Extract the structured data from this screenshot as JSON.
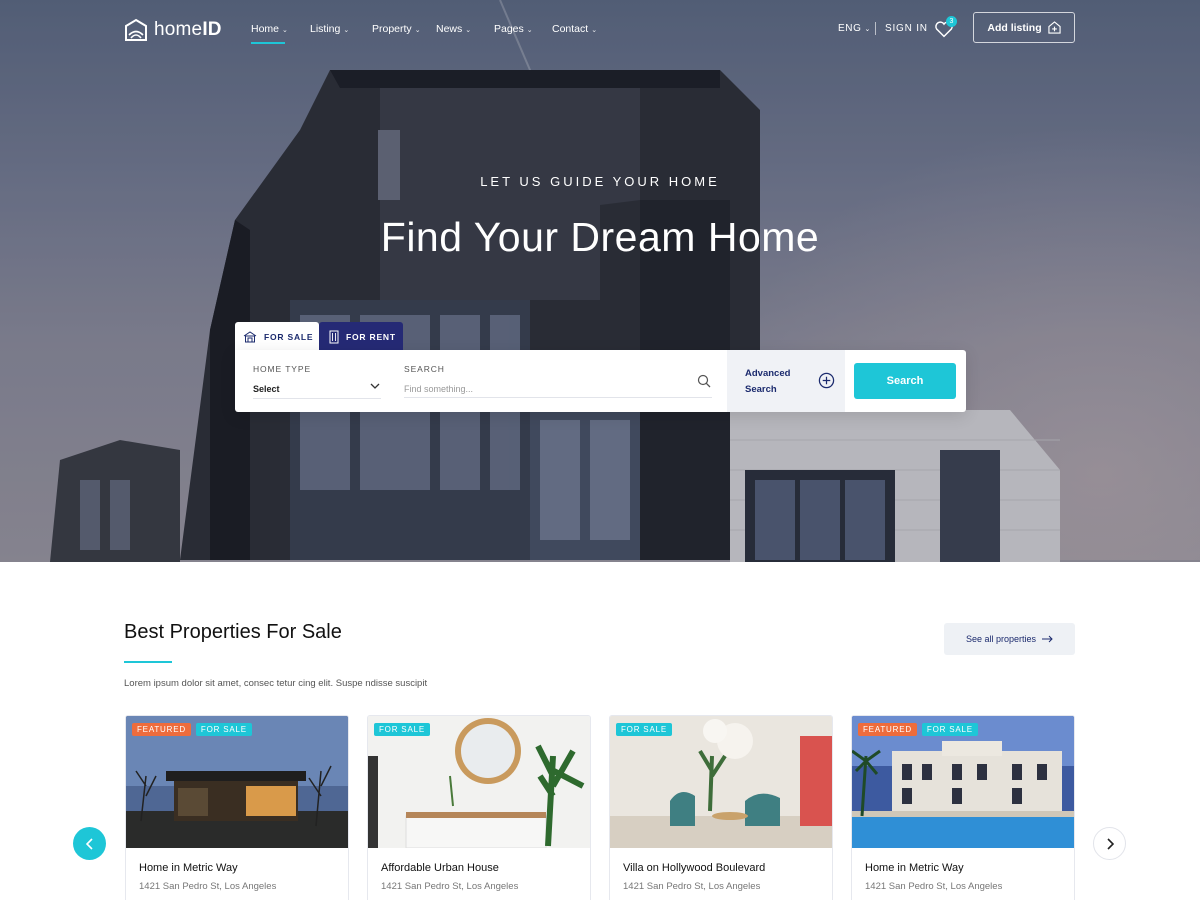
{
  "brand": {
    "name_light": "home",
    "name_bold": "ID"
  },
  "nav": {
    "items": [
      {
        "label": "Home",
        "active": true
      },
      {
        "label": "Listing",
        "active": false
      },
      {
        "label": "Property",
        "active": false
      },
      {
        "label": "News",
        "active": false
      },
      {
        "label": "Pages",
        "active": false
      },
      {
        "label": "Contact",
        "active": false
      }
    ],
    "language": "ENG",
    "sign_in": "SIGN IN",
    "wishlist_count": "3",
    "add_listing": "Add listing"
  },
  "hero": {
    "eyebrow": "LET US GUIDE YOUR HOME",
    "title": "Find Your Dream Home"
  },
  "search": {
    "tabs": [
      {
        "label": "FOR SALE",
        "active": true
      },
      {
        "label": "FOR RENT",
        "active": false
      }
    ],
    "home_type_label": "HOME TYPE",
    "home_type_value": "Select",
    "search_label": "SEARCH",
    "search_placeholder": "Find something...",
    "advanced_line1": "Advanced",
    "advanced_line2": "Search",
    "button": "Search"
  },
  "section": {
    "title": "Best Properties For Sale",
    "description": "Lorem ipsum dolor sit amet, consec tetur cing elit. Suspe ndisse suscipit",
    "see_all": "See all properties"
  },
  "properties": [
    {
      "title": "Home in Metric Way",
      "address": "1421 San Pedro St, Los Angeles",
      "badges": [
        "FEATURED",
        "FOR SALE"
      ],
      "image": "modern-house-dusk"
    },
    {
      "title": "Affordable Urban House",
      "address": "1421 San Pedro St, Los Angeles",
      "badges": [
        "FOR SALE"
      ],
      "image": "interior-mirror-plant"
    },
    {
      "title": "Villa on Hollywood Boulevard",
      "address": "1421 San Pedro St, Los Angeles",
      "badges": [
        "FOR SALE"
      ],
      "image": "lounge-teal-chairs"
    },
    {
      "title": "Home in Metric Way",
      "address": "1421 San Pedro St, Los Angeles",
      "badges": [
        "FEATURED",
        "FOR SALE"
      ],
      "image": "villa-pool-night"
    }
  ],
  "colors": {
    "accent": "#1ec6d7",
    "navy": "#1c2b6e",
    "featured": "#ee6c3c",
    "rent_tab": "#252a75"
  },
  "icons": [
    "home-logo-icon",
    "heart-icon",
    "add-listing-icon",
    "sale-tab-icon",
    "rent-tab-icon",
    "chevron-down-icon",
    "search-icon",
    "plus-circle-icon",
    "arrow-right-icon",
    "chevron-left-icon",
    "chevron-right-icon"
  ]
}
